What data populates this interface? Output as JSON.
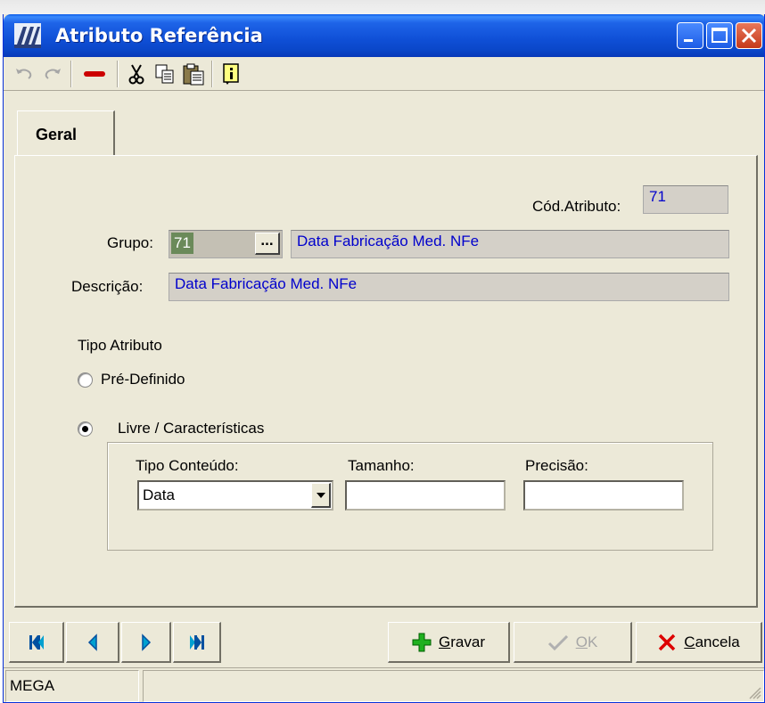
{
  "window": {
    "title": "Atributo Referência"
  },
  "tabs": [
    {
      "label": "Geral"
    }
  ],
  "form": {
    "cod_atributo_label": "Cód.Atributo:",
    "cod_atributo_value": "71",
    "grupo_label": "Grupo:",
    "grupo_code": "71",
    "grupo_lookup_label": "...",
    "grupo_description": "Data Fabricação Med. NFe",
    "descricao_label": "Descrição:",
    "descricao_value": "Data Fabricação Med. NFe",
    "tipo_atributo_label": "Tipo Atributo",
    "option_predefinido": "Pré-Definido",
    "option_livre": "Livre / Características",
    "selected_option": "livre",
    "tipo_conteudo_label": "Tipo Conteúdo:",
    "tipo_conteudo_value": "Data",
    "tamanho_label": "Tamanho:",
    "tamanho_value": "",
    "precisao_label": "Precisão:",
    "precisao_value": ""
  },
  "buttons": {
    "gravar_prefix": "",
    "gravar_u": "G",
    "gravar_rest": "ravar",
    "ok_u": "O",
    "ok_rest": "K",
    "cancela_u": "C",
    "cancela_rest": "ancela"
  },
  "status": {
    "text": "MEGA"
  },
  "colors": {
    "titlebar": "#0a46c8",
    "value_text": "#0000cc",
    "window_bg": "#ece9d8"
  }
}
